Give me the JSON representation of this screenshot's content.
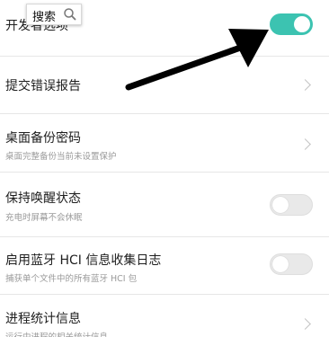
{
  "search": {
    "label": "搜索",
    "icon": "search-icon"
  },
  "colors": {
    "toggle_on": "#3cc3b1",
    "toggle_off": "#e9e9e9",
    "arrow": "#000000"
  },
  "rows": [
    {
      "title": "开发者选项",
      "control": "toggle",
      "state": "on"
    },
    {
      "title": "提交错误报告",
      "control": "chevron"
    },
    {
      "title": "桌面备份密码",
      "subtitle": "桌面完整备份当前未设置保护",
      "control": "chevron"
    },
    {
      "title": "保持唤醒状态",
      "subtitle": "充电时屏幕不会休眠",
      "control": "toggle",
      "state": "off"
    },
    {
      "title": "启用蓝牙 HCI 信息收集日志",
      "subtitle": "捕获单个文件中的所有蓝牙 HCI 包",
      "control": "toggle",
      "state": "off"
    },
    {
      "title": "进程统计信息",
      "subtitle": "运行中进程的相关统计信息",
      "control": "chevron"
    }
  ]
}
